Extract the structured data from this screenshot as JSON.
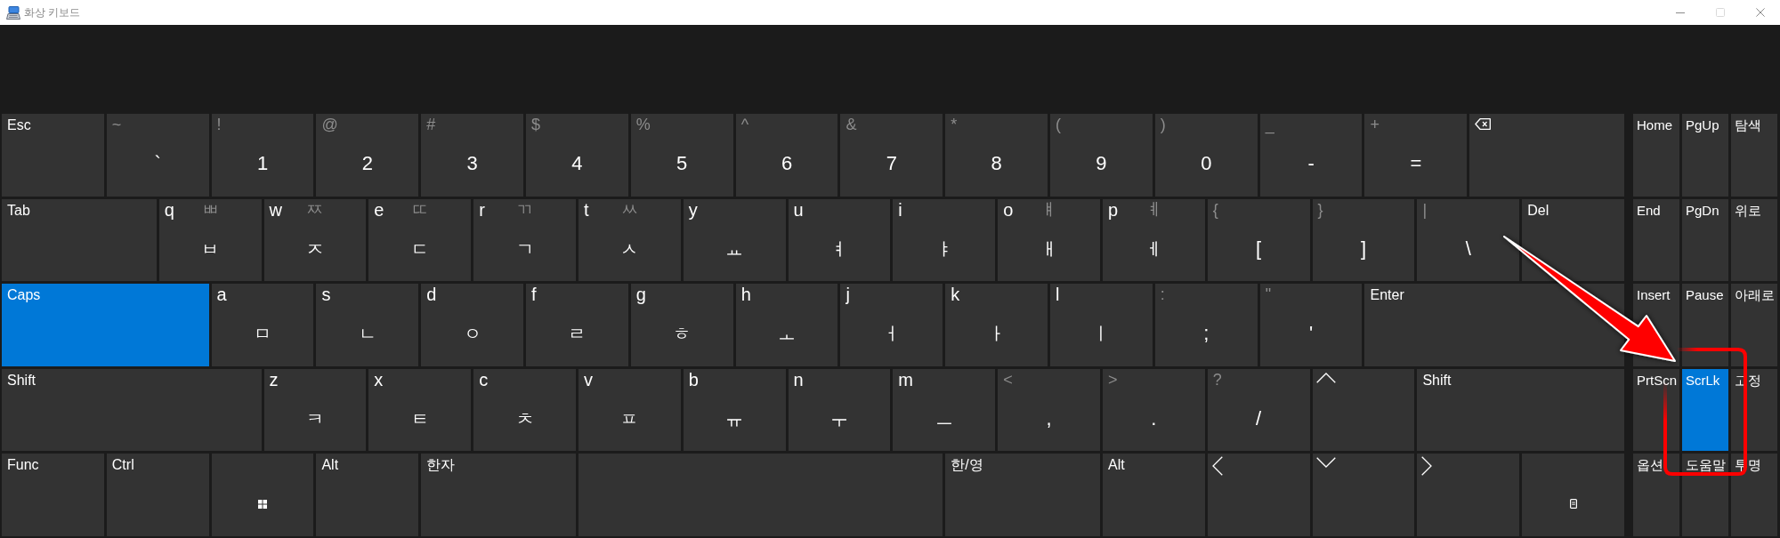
{
  "window": {
    "title": "화상 키보드",
    "controls": [
      {
        "kind": "minimize",
        "disabled": false
      },
      {
        "kind": "maximize",
        "disabled": true
      },
      {
        "kind": "close",
        "disabled": false
      }
    ]
  },
  "keyboard": {
    "rows": [
      [
        {
          "kind": "label",
          "label": "Esc",
          "on": false
        },
        {
          "kind": "char",
          "shift": "~",
          "main": "`",
          "on": false
        },
        {
          "kind": "char",
          "shift": "!",
          "main": "1",
          "on": false
        },
        {
          "kind": "char",
          "shift": "@",
          "main": "2",
          "on": false
        },
        {
          "kind": "char",
          "shift": "#",
          "main": "3",
          "on": false
        },
        {
          "kind": "char",
          "shift": "$",
          "main": "4",
          "on": false
        },
        {
          "kind": "char",
          "shift": "%",
          "main": "5",
          "on": false
        },
        {
          "kind": "char",
          "shift": "^",
          "main": "6",
          "on": false
        },
        {
          "kind": "char",
          "shift": "&",
          "main": "7",
          "on": false
        },
        {
          "kind": "char",
          "shift": "*",
          "main": "8",
          "on": false
        },
        {
          "kind": "char",
          "shift": "(",
          "main": "9",
          "on": false
        },
        {
          "kind": "char",
          "shift": ")",
          "main": "0",
          "on": false
        },
        {
          "kind": "char",
          "shift": "_",
          "main": "-",
          "on": false
        },
        {
          "kind": "char",
          "shift": "+",
          "main": "=",
          "on": false
        },
        {
          "kind": "backspace",
          "on": false
        }
      ],
      [
        {
          "kind": "label",
          "label": "Tab",
          "on": false
        },
        {
          "kind": "letter",
          "letter": "q",
          "shift": "ㅃ",
          "main": "ㅂ",
          "on": false
        },
        {
          "kind": "letter",
          "letter": "w",
          "shift": "ㅉ",
          "main": "ㅈ",
          "on": false
        },
        {
          "kind": "letter",
          "letter": "e",
          "shift": "ㄸ",
          "main": "ㄷ",
          "on": false
        },
        {
          "kind": "letter",
          "letter": "r",
          "shift": "ㄲ",
          "main": "ㄱ",
          "on": false
        },
        {
          "kind": "letter",
          "letter": "t",
          "shift": "ㅆ",
          "main": "ㅅ",
          "on": false
        },
        {
          "kind": "letter",
          "letter": "y",
          "main": "ㅛ",
          "on": false
        },
        {
          "kind": "letter",
          "letter": "u",
          "main": "ㅕ",
          "on": false
        },
        {
          "kind": "letter",
          "letter": "i",
          "main": "ㅑ",
          "on": false
        },
        {
          "kind": "letter",
          "letter": "o",
          "shift": "ㅒ",
          "main": "ㅐ",
          "on": false
        },
        {
          "kind": "letter",
          "letter": "p",
          "shift": "ㅖ",
          "main": "ㅔ",
          "on": false
        },
        {
          "kind": "char",
          "shift": "{",
          "main": "[",
          "on": false
        },
        {
          "kind": "char",
          "shift": "}",
          "main": "]",
          "on": false
        },
        {
          "kind": "char",
          "shift": "|",
          "main": "\\",
          "on": false
        },
        {
          "kind": "label",
          "label": "Del",
          "on": false
        }
      ],
      [
        {
          "kind": "label",
          "label": "Caps",
          "on": true
        },
        {
          "kind": "letter",
          "letter": "a",
          "main": "ㅁ",
          "on": false
        },
        {
          "kind": "letter",
          "letter": "s",
          "main": "ㄴ",
          "on": false
        },
        {
          "kind": "letter",
          "letter": "d",
          "main": "ㅇ",
          "on": false
        },
        {
          "kind": "letter",
          "letter": "f",
          "main": "ㄹ",
          "on": false
        },
        {
          "kind": "letter",
          "letter": "g",
          "main": "ㅎ",
          "on": false
        },
        {
          "kind": "letter",
          "letter": "h",
          "main": "ㅗ",
          "on": false
        },
        {
          "kind": "letter",
          "letter": "j",
          "main": "ㅓ",
          "on": false
        },
        {
          "kind": "letter",
          "letter": "k",
          "main": "ㅏ",
          "on": false
        },
        {
          "kind": "letter",
          "letter": "l",
          "main": "ㅣ",
          "on": false
        },
        {
          "kind": "char",
          "shift": ":",
          "main": ";",
          "on": false
        },
        {
          "kind": "char",
          "shift": "\"",
          "main": "'",
          "on": false
        },
        {
          "kind": "label",
          "label": "Enter",
          "on": false
        }
      ],
      [
        {
          "kind": "label",
          "label": "Shift",
          "on": false
        },
        {
          "kind": "letter",
          "letter": "z",
          "main": "ㅋ",
          "on": false
        },
        {
          "kind": "letter",
          "letter": "x",
          "main": "ㅌ",
          "on": false
        },
        {
          "kind": "letter",
          "letter": "c",
          "main": "ㅊ",
          "on": false
        },
        {
          "kind": "letter",
          "letter": "v",
          "main": "ㅍ",
          "on": false
        },
        {
          "kind": "letter",
          "letter": "b",
          "main": "ㅠ",
          "on": false
        },
        {
          "kind": "letter",
          "letter": "n",
          "main": "ㅜ",
          "on": false
        },
        {
          "kind": "letter",
          "letter": "m",
          "main": "ㅡ",
          "on": false
        },
        {
          "kind": "char",
          "shift": "<",
          "main": ",",
          "on": false
        },
        {
          "kind": "char",
          "shift": ">",
          "main": ".",
          "on": false
        },
        {
          "kind": "char",
          "shift": "?",
          "main": "/",
          "on": false
        },
        {
          "kind": "up",
          "on": false
        },
        {
          "kind": "label",
          "label": "Shift",
          "on": false
        }
      ],
      [
        {
          "kind": "label",
          "label": "Func",
          "on": false
        },
        {
          "kind": "label",
          "label": "Ctrl",
          "on": false
        },
        {
          "kind": "windows",
          "on": false
        },
        {
          "kind": "label",
          "label": "Alt",
          "on": false
        },
        {
          "kind": "label",
          "label": "한자",
          "on": false
        },
        {
          "kind": "space",
          "on": false
        },
        {
          "kind": "label",
          "label": "한/영",
          "on": false
        },
        {
          "kind": "label",
          "label": "Alt",
          "on": false
        },
        {
          "kind": "left",
          "on": false
        },
        {
          "kind": "down",
          "on": false
        },
        {
          "kind": "right",
          "on": false
        },
        {
          "kind": "menu",
          "on": false
        }
      ]
    ]
  },
  "nav_keys": {
    "rows": [
      [
        {
          "kind": "label",
          "label": "Home",
          "on": false
        },
        {
          "kind": "label",
          "label": "PgUp",
          "on": false
        },
        {
          "kind": "label",
          "label": "탐색",
          "on": false
        }
      ],
      [
        {
          "kind": "label",
          "label": "End",
          "on": false
        },
        {
          "kind": "label",
          "label": "PgDn",
          "on": false
        },
        {
          "kind": "label",
          "label": "위로",
          "on": false
        }
      ],
      [
        {
          "kind": "label",
          "label": "Insert",
          "on": false
        },
        {
          "kind": "label",
          "label": "Pause",
          "on": false
        },
        {
          "kind": "label",
          "label": "아래로",
          "on": false
        }
      ],
      [
        {
          "kind": "label",
          "label": "PrtScn",
          "on": false
        },
        {
          "kind": "label",
          "label": "ScrLk",
          "on": true
        },
        {
          "kind": "label",
          "label": "고정",
          "on": false
        }
      ],
      [
        {
          "kind": "label",
          "label": "옵션",
          "on": false
        },
        {
          "kind": "label",
          "label": "도움말",
          "on": false
        },
        {
          "kind": "label",
          "label": "투명",
          "on": false
        }
      ]
    ]
  }
}
